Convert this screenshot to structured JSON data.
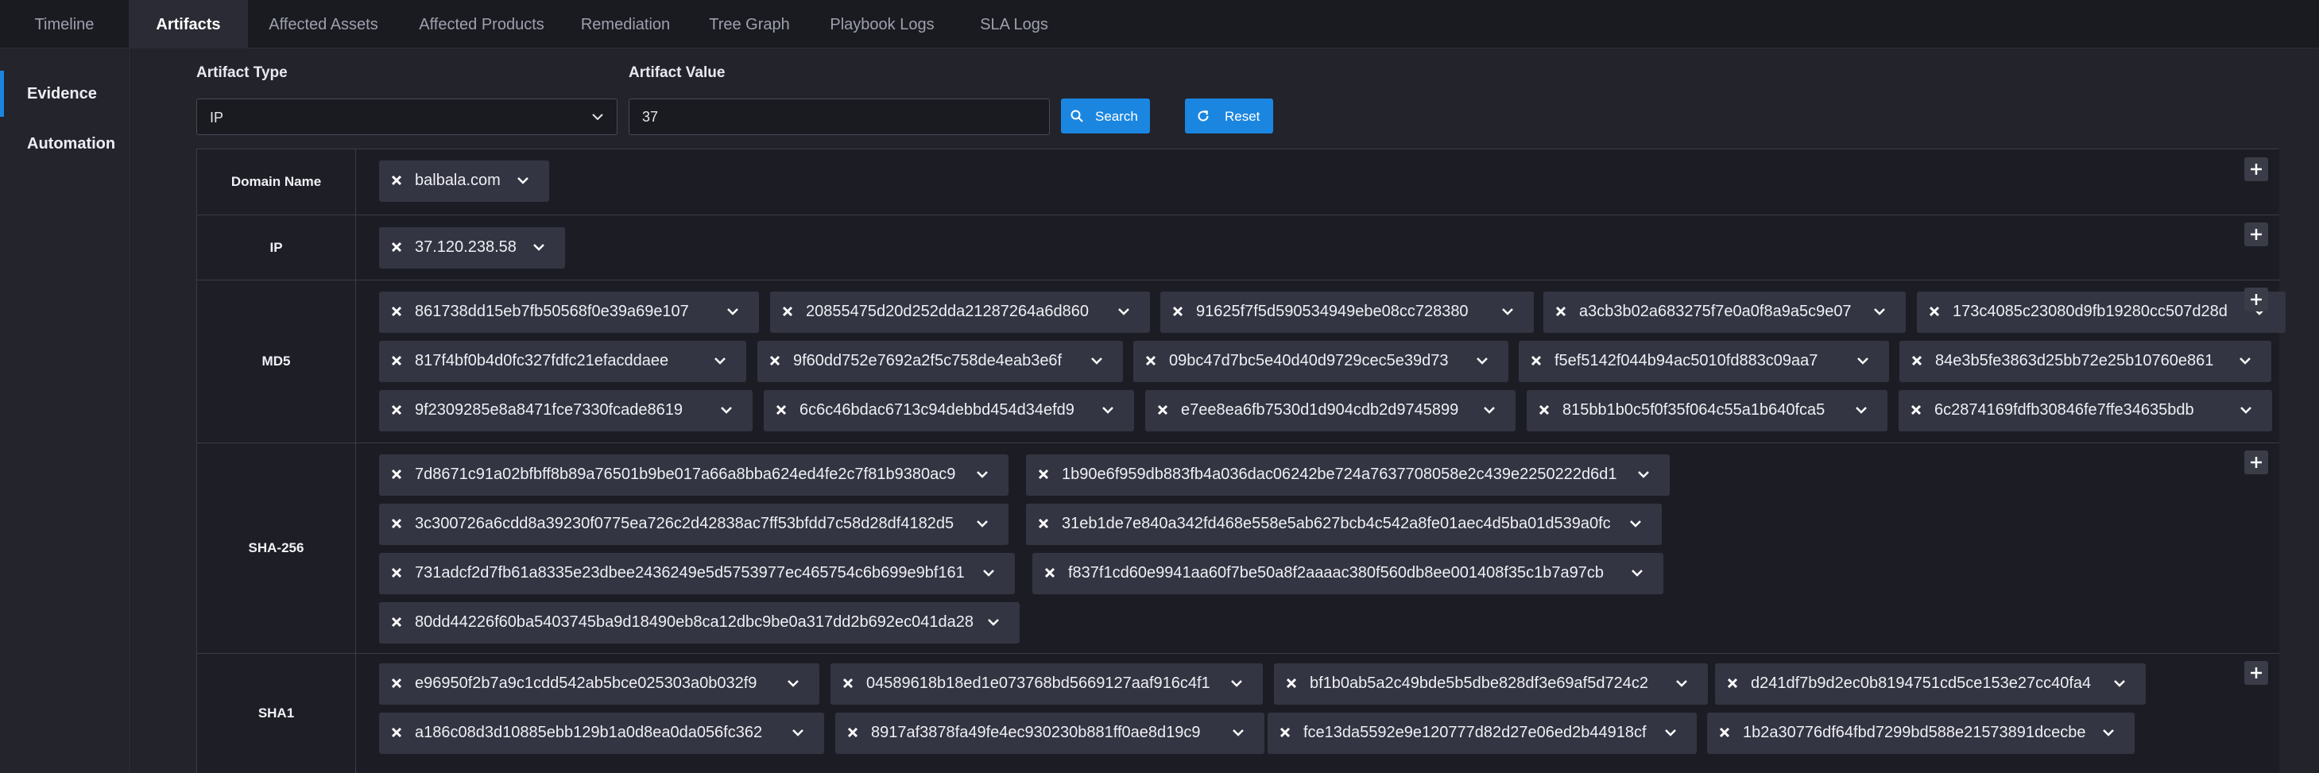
{
  "tabs": [
    {
      "label": "Timeline",
      "active": false
    },
    {
      "label": "Artifacts",
      "active": true
    },
    {
      "label": "Affected Assets",
      "active": false
    },
    {
      "label": "Affected Products",
      "active": false
    },
    {
      "label": "Remediation",
      "active": false
    },
    {
      "label": "Tree Graph",
      "active": false
    },
    {
      "label": "Playbook Logs",
      "active": false
    },
    {
      "label": "SLA Logs",
      "active": false
    }
  ],
  "sidenav": {
    "items": [
      {
        "label": "Evidence",
        "active": true
      },
      {
        "label": "Automation",
        "active": false
      }
    ]
  },
  "filters": {
    "artifact_type_label": "Artifact Type",
    "artifact_type_value": "IP",
    "artifact_value_label": "Artifact Value",
    "artifact_value": "37",
    "search_label": "Search",
    "reset_label": "Reset"
  },
  "colors": {
    "accent": "#1b86e0",
    "background": "#1c1d24",
    "tag": "#343542"
  },
  "artifact_rows": [
    {
      "label": "Domain Name",
      "tags": [
        "balbala.com"
      ]
    },
    {
      "label": "IP",
      "tags": [
        "37.120.238.58"
      ]
    },
    {
      "label": "MD5",
      "tags": [
        "861738dd15eb7fb50568f0e39a69e107",
        "20855475d20d252dda21287264a6d860",
        "91625f7f5d590534949ebe08cc728380",
        "a3cb3b02a683275f7e0a0f8a9a5c9e07",
        "173c4085c23080d9fb19280cc507d28d",
        "817f4bf0b4d0fc327fdfc21efacddaee",
        "9f60dd752e7692a2f5c758de4eab3e6f",
        "09bc47d7bc5e40d40d9729cec5e39d73",
        "f5ef5142f044b94ac5010fd883c09aa7",
        "84e3b5fe3863d25bb72e25b10760e861",
        "9f2309285e8a8471fce7330fcade8619",
        "6c6c46bdac6713c94debbd454d34efd9",
        "e7ee8ea6fb7530d1d904cdb2d9745899",
        "815bb1b0c5f0f35f064c55a1b640fca5",
        "6c2874169fdfb30846fe7ffe34635bdb"
      ]
    },
    {
      "label": "SHA-256",
      "tags": [
        "7d8671c91a02bfbff8b89a76501b9be017a66a8bba624ed4fe2c7f81b9380ac9",
        "1b90e6f959db883fb4a036dac06242be724a7637708058e2c439e2250222d6d1",
        "3c300726a6cdd8a39230f0775ea726c2d42838ac7ff53bfdd7c58d28df4182d5",
        "31eb1de7e840a342fd468e558e5ab627bcb4c542a8fe01aec4d5ba01d539a0fc",
        "731adcf2d7fb61a8335e23dbee2436249e5d5753977ec465754c6b699e9bf161",
        "f837f1cd60e9941aa60f7be50a8f2aaaac380f560db8ee001408f35c1b7a97cb",
        "80dd44226f60ba5403745ba9d18490eb8ca12dbc9be0a317dd2b692ec041da28"
      ]
    },
    {
      "label": "SHA1",
      "tags": [
        "e96950f2b7a9c1cdd542ab5bce025303a0b032f9",
        "04589618b18ed1e073768bd5669127aaf916c4f1",
        "bf1b0ab5a2c49bde5b5dbe828df3e69af5d724c2",
        "d241df7b9d2ec0b8194751cd5ce153e27cc40fa4",
        "a186c08d3d10885ebb129b1a0d8ea0da056fc362",
        "8917af3878fa49fe4ec930230b881ff0ae8d19c9",
        "fce13da5592e9e120777d82d27e06ed2b44918cf",
        "1b2a30776df64fbd7299bd588e21573891dcecbe"
      ]
    }
  ]
}
